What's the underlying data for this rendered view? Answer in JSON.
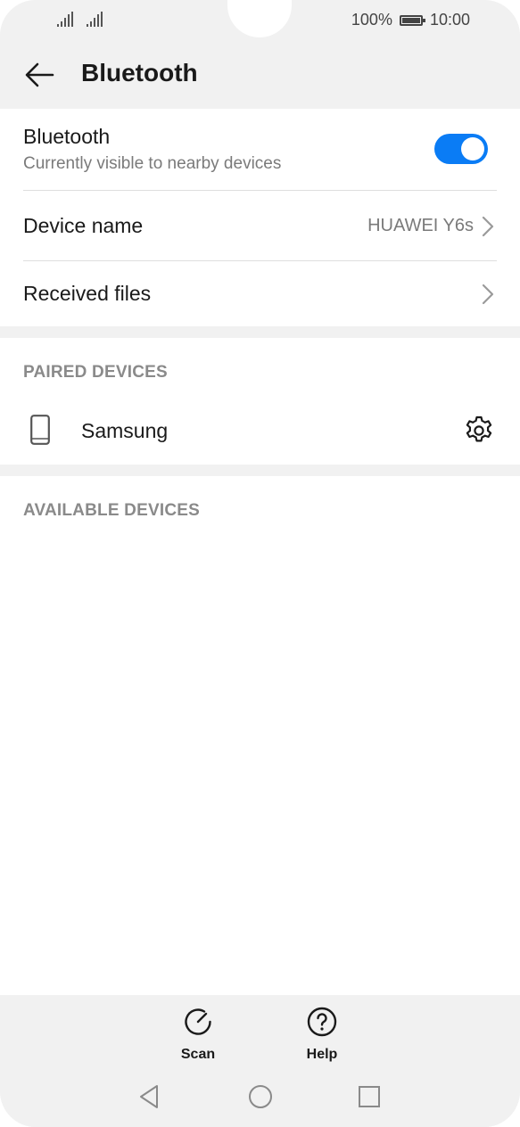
{
  "status_bar": {
    "battery_percent": "100%",
    "time": "10:00"
  },
  "app_bar": {
    "title": "Bluetooth",
    "back_icon": "arrow-left-icon"
  },
  "bluetooth_row": {
    "title": "Bluetooth",
    "subtitle": "Currently visible to nearby devices",
    "enabled": true,
    "toggle_color": "#0a7cf5"
  },
  "device_name_row": {
    "title": "Device name",
    "value": "HUAWEI Y6s"
  },
  "received_files_row": {
    "title": "Received files"
  },
  "paired_devices": {
    "header": "PAIRED DEVICES",
    "items": [
      {
        "name": "Samsung",
        "icon": "phone-icon",
        "action_icon": "gear-icon"
      }
    ]
  },
  "available_devices": {
    "header": "AVAILABLE DEVICES"
  },
  "bottom_actions": {
    "scan_label": "Scan",
    "help_label": "Help"
  },
  "nav_bar": {
    "buttons": [
      "back-triangle-icon",
      "home-circle-icon",
      "recents-square-icon"
    ]
  }
}
